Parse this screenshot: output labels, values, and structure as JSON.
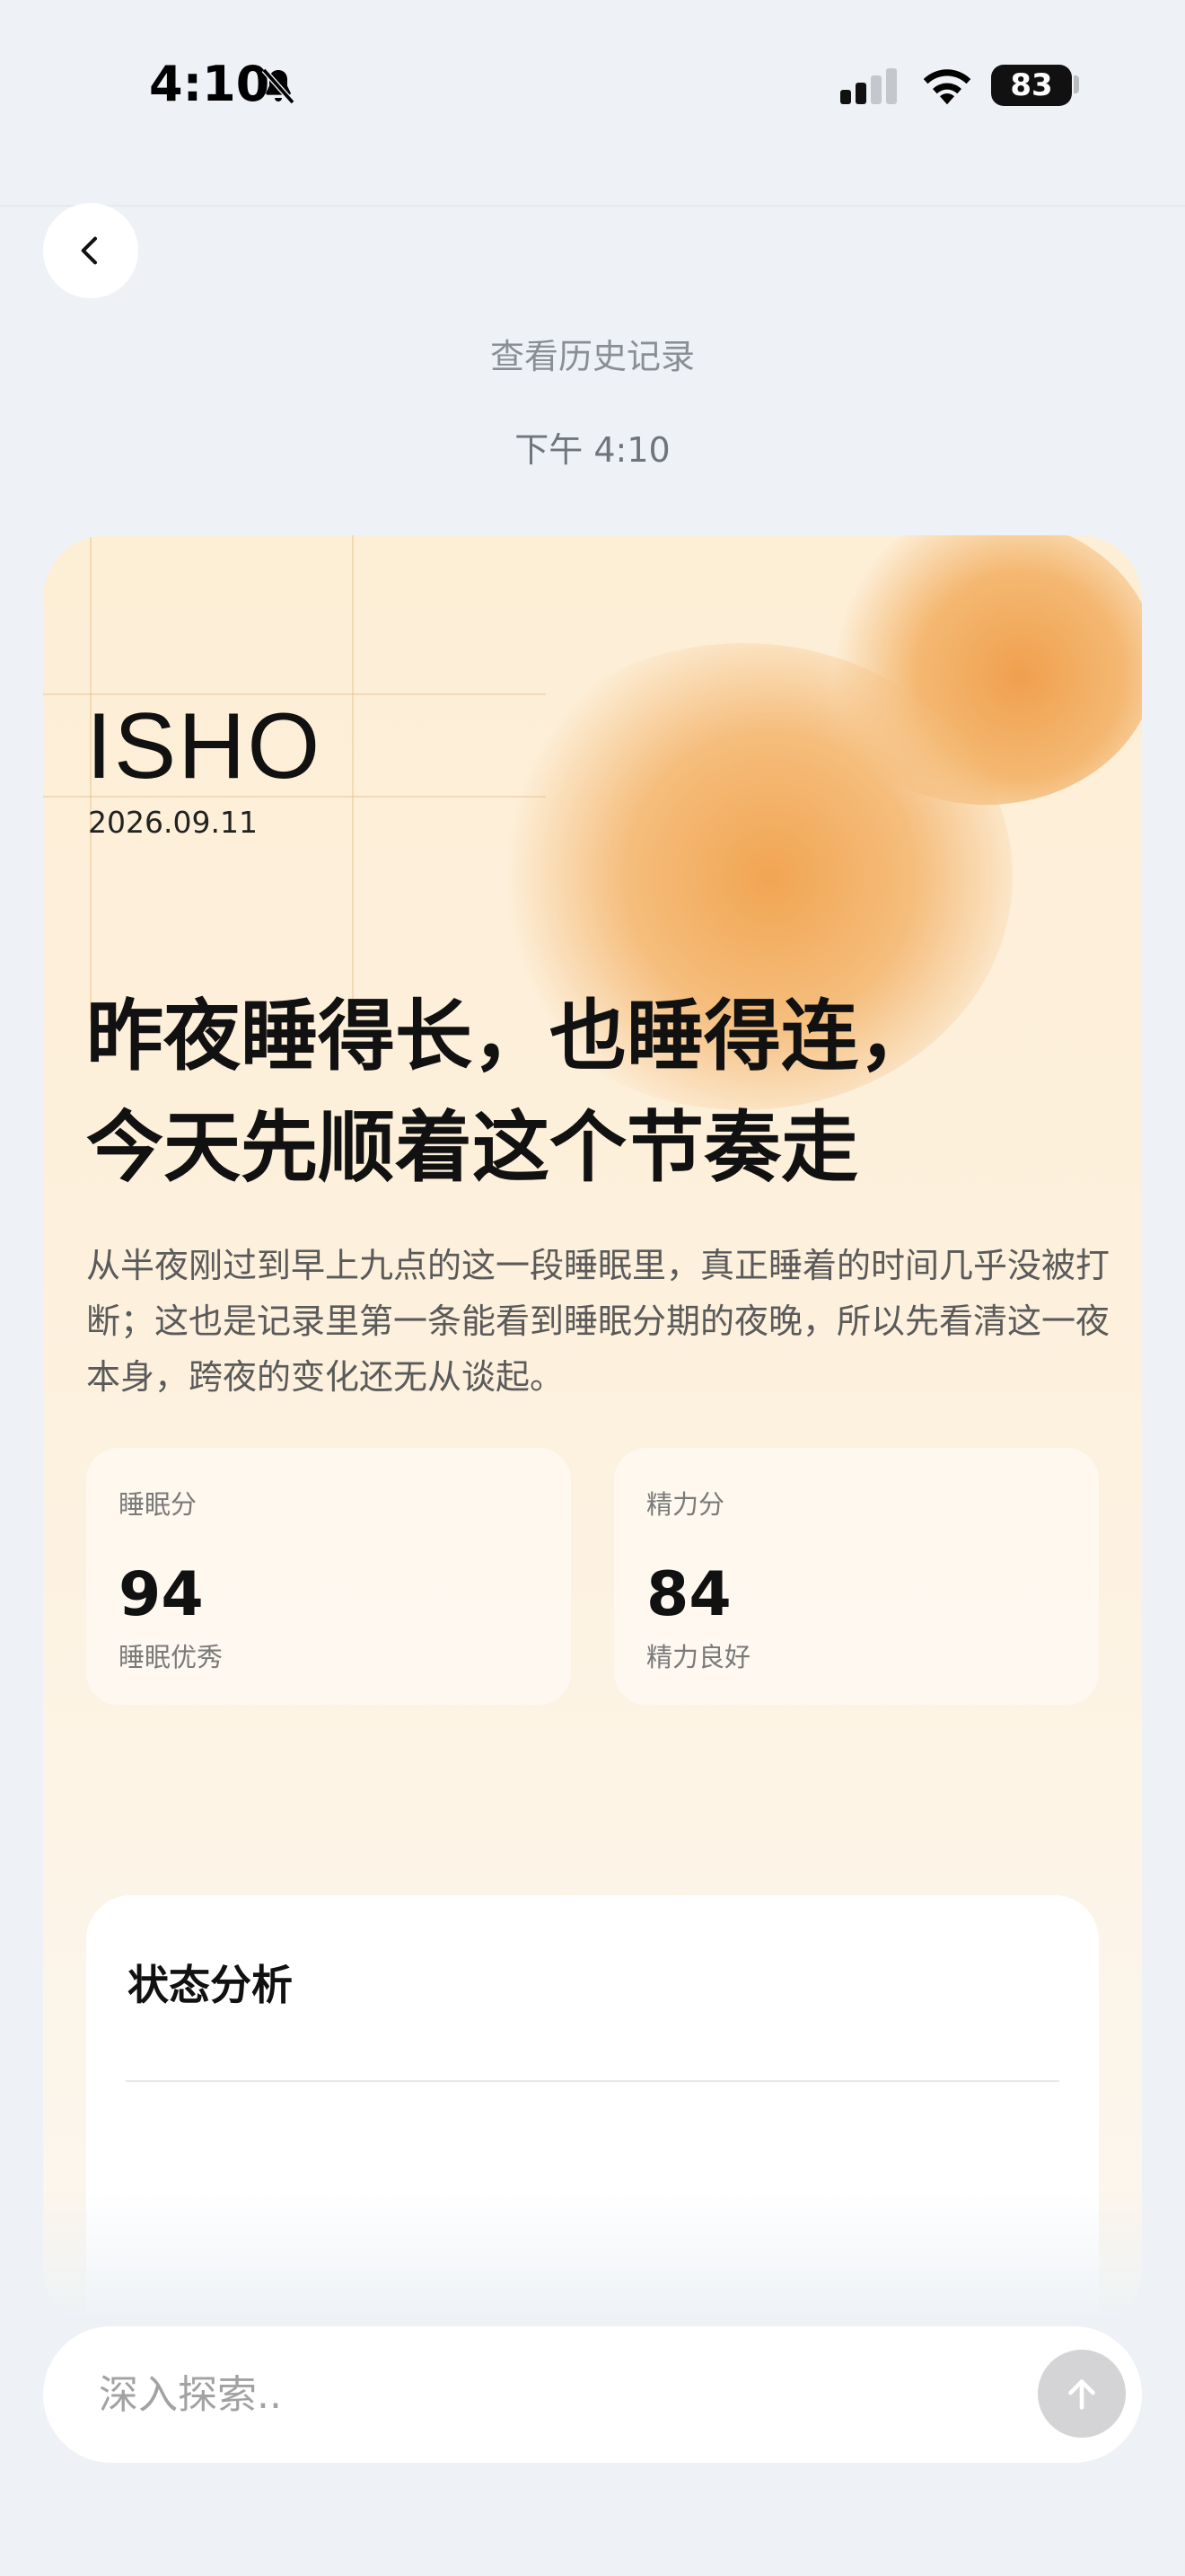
{
  "status_bar": {
    "time": "4:10",
    "battery": "83"
  },
  "header": {
    "history_link": "查看历史记录",
    "time_label": "下午 4:10"
  },
  "report": {
    "brand": "ISHO",
    "date": "2026.09.11",
    "headline_line1": "昨夜睡得长，也睡得连，",
    "headline_line2": "今天先顺着这个节奏走",
    "summary": "从半夜刚过到早上九点的这一段睡眠里，真正睡着的时间几乎没被打断；这也是记录里第一条能看到睡眠分期的夜晚，所以先看清这一夜本身，跨夜的变化还无从谈起。",
    "metrics": [
      {
        "label": "睡眠分",
        "value": "94",
        "desc": "睡眠优秀"
      },
      {
        "label": "精力分",
        "value": "84",
        "desc": "精力良好"
      }
    ],
    "analysis_title": "状态分析"
  },
  "input": {
    "placeholder": "深入探索.."
  },
  "colors": {
    "accent": "#f1a552",
    "background": "#eef2f6"
  }
}
